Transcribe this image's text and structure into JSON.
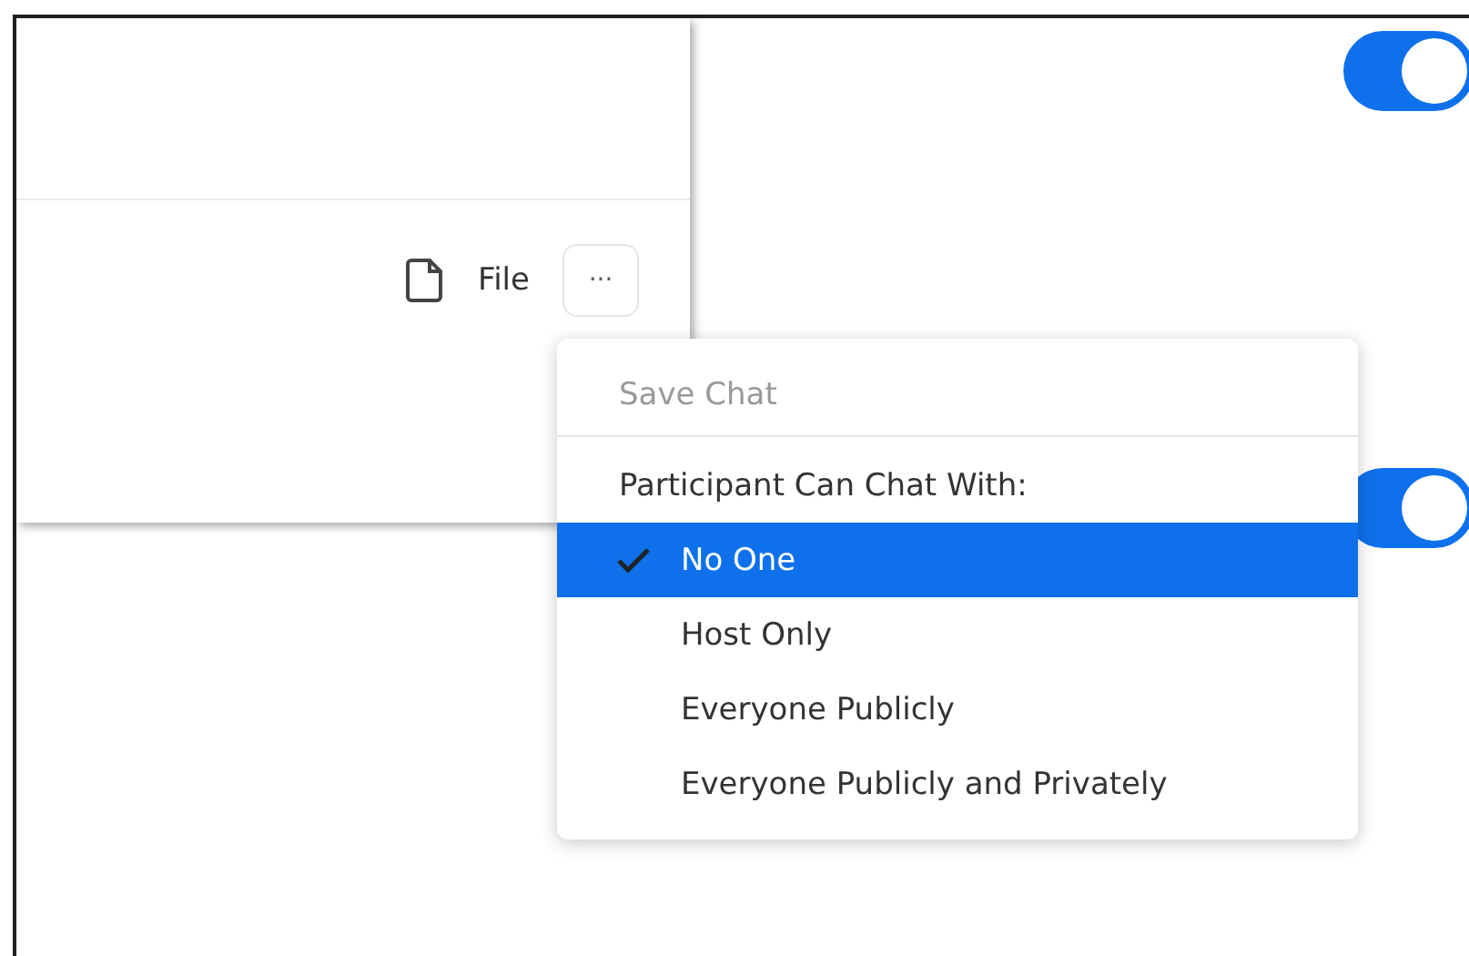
{
  "chat_panel": {
    "file_button": {
      "label": "File"
    },
    "more_button": {
      "label": "···"
    }
  },
  "toggles": [
    {
      "on": true
    },
    {
      "on": true
    }
  ],
  "menu": {
    "items": [
      {
        "kind": "action",
        "label": "Save Chat",
        "disabled": true
      },
      {
        "kind": "header",
        "label": "Participant Can Chat With:"
      },
      {
        "kind": "option",
        "label": "No One",
        "selected": true
      },
      {
        "kind": "option",
        "label": "Host Only",
        "selected": false
      },
      {
        "kind": "option",
        "label": "Everyone Publicly",
        "selected": false
      },
      {
        "kind": "option",
        "label": "Everyone Publicly and Privately",
        "selected": false
      }
    ]
  }
}
